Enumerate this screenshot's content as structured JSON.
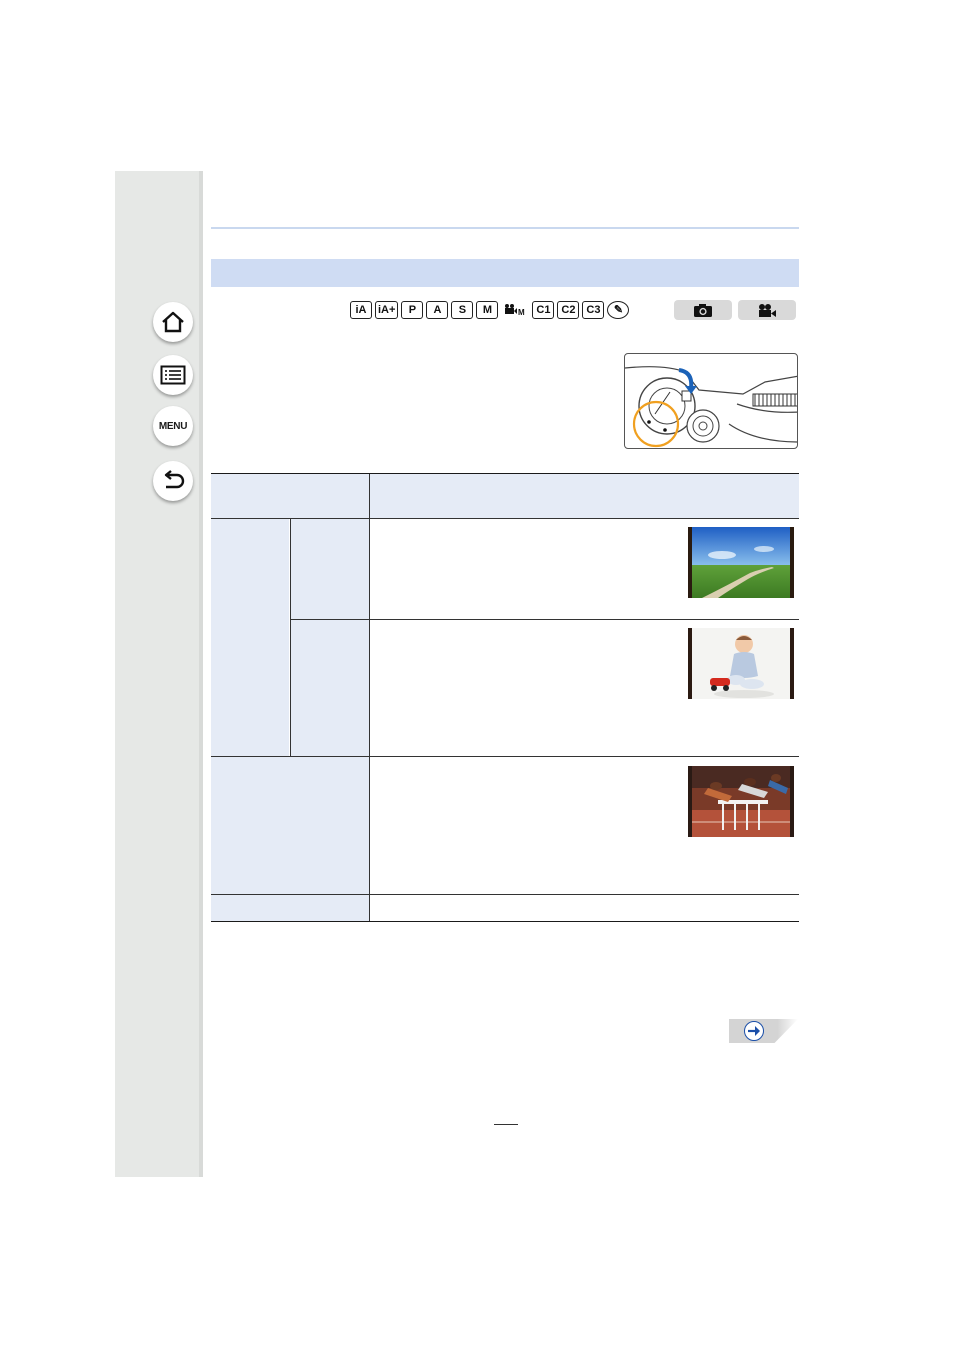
{
  "sidebar": {
    "items": [
      {
        "name": "home",
        "icon": "home-icon"
      },
      {
        "name": "contents",
        "icon": "list-icon"
      },
      {
        "name": "menu",
        "icon": "menu-icon",
        "label": "MENU"
      },
      {
        "name": "back",
        "icon": "back-arrow-icon"
      }
    ]
  },
  "modes": [
    "iA",
    "iA+",
    "P",
    "A",
    "S",
    "M",
    " M",
    "C1",
    "C2",
    "C3",
    "✎"
  ],
  "badges": [
    {
      "name": "still-picture",
      "icon": "camera-icon"
    },
    {
      "name": "motion-picture",
      "icon": "movie-camera-icon"
    }
  ],
  "photos": [
    {
      "name": "landscape-photo",
      "subject": "grass field with dirt path under blue sky"
    },
    {
      "name": "baby-photo",
      "subject": "baby with toy car"
    },
    {
      "name": "hurdles-photo",
      "subject": "hurdle race runners"
    }
  ],
  "colors": {
    "sidebar_bg": "#e6e8e6",
    "section_bar": "#cfdcf3",
    "table_shade": "#e5ebf6",
    "accent_blue": "#1b4fa8",
    "highlight_orange": "#f0a020"
  },
  "page_number": ""
}
